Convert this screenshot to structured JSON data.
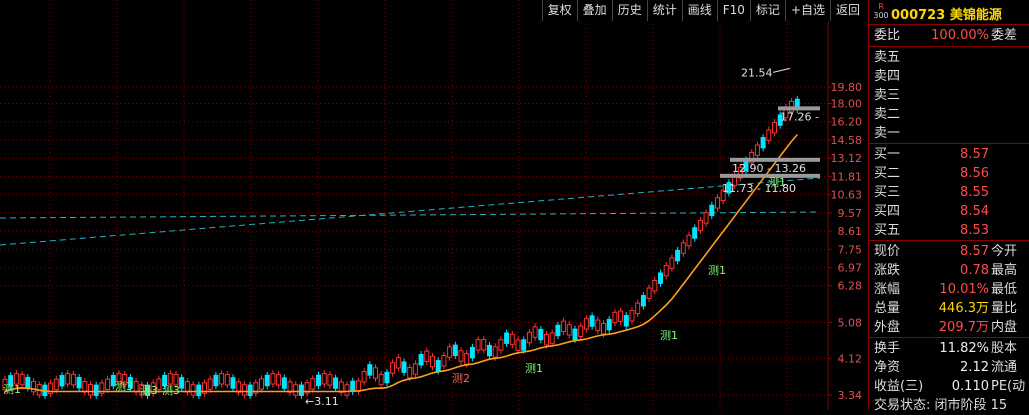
{
  "toolbar": {
    "buttons": [
      "复权",
      "叠加",
      "历史",
      "统计",
      "画线",
      "F10",
      "标记",
      "+自选",
      "返回"
    ]
  },
  "chart": {
    "price_axis_labels": [
      "19.80",
      "18.00",
      "16.20",
      "14.58",
      "13.12",
      "11.81",
      "10.63",
      "9.57",
      "8.61",
      "7.75",
      "6.97",
      "6.28",
      "5.08",
      "4.12",
      "3.34"
    ],
    "high_marker": "21.54",
    "low_marker": "3.11",
    "zone_labels": [
      "17.26 -",
      "12.90 - 13.26",
      "11.73 - 11.80"
    ],
    "tags": [
      "测1",
      "测1",
      "测1",
      "测1",
      "测1",
      "测3",
      "测3",
      "测3",
      "测2"
    ],
    "colors": {
      "up": "#ff3030",
      "down": "#00e5ff",
      "ma": "#ff9f1a",
      "trend": "#1fb5c4",
      "grid": "#7a0000",
      "zone": "#9a9a9a"
    }
  },
  "chart_data": {
    "type": "candlestick",
    "y_scale": "log",
    "ylim": [
      3.34,
      21.54
    ],
    "high": 21.54,
    "low": 3.11
  },
  "panel": {
    "badge_top": "R",
    "badge_bottom": "300",
    "stock_code": "000723",
    "stock_name": "美锦能源",
    "commission_ratio": {
      "label": "委比",
      "value": "100.00%",
      "label2": "委差"
    },
    "asks": [
      {
        "label": "卖五",
        "value": ""
      },
      {
        "label": "卖四",
        "value": ""
      },
      {
        "label": "卖三",
        "value": ""
      },
      {
        "label": "卖二",
        "value": ""
      },
      {
        "label": "卖一",
        "value": ""
      }
    ],
    "bids": [
      {
        "label": "买一",
        "value": "8.57"
      },
      {
        "label": "买二",
        "value": "8.56"
      },
      {
        "label": "买三",
        "value": "8.55"
      },
      {
        "label": "买四",
        "value": "8.54"
      },
      {
        "label": "买五",
        "value": "8.53"
      }
    ],
    "quote": [
      {
        "label": "现价",
        "value": "8.57",
        "label2": "今开"
      },
      {
        "label": "涨跌",
        "value": "0.78",
        "label2": "最高"
      },
      {
        "label": "涨幅",
        "value": "10.01%",
        "label2": "最低"
      },
      {
        "label": "总量",
        "value": "446.3万",
        "label2": "量比"
      },
      {
        "label": "外盘",
        "value": "209.7万",
        "label2": "内盘"
      }
    ],
    "fundamentals": [
      {
        "label": "换手",
        "value": "11.82%",
        "label2": "股本"
      },
      {
        "label": "净资",
        "value": "2.12",
        "label2": "流通"
      },
      {
        "label": "收益(三)",
        "value": "0.110",
        "label2": "PE(动"
      }
    ],
    "status": "交易状态: 闭市阶段 15"
  }
}
